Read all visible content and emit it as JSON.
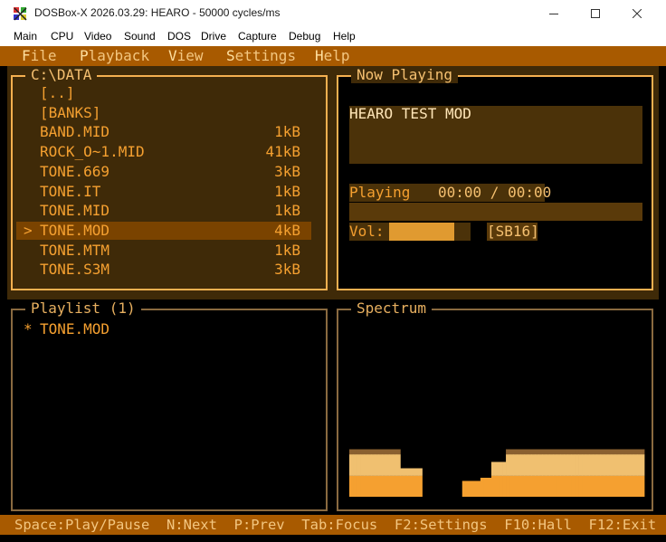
{
  "window": {
    "title": "DOSBox-X 2026.03.29: HEARO - 50000 cycles/ms",
    "icon": "dosbox-icon"
  },
  "host_menu": [
    "Main",
    "CPU",
    "Video",
    "Sound",
    "DOS",
    "Drive",
    "Capture",
    "Debug",
    "Help"
  ],
  "app_menu": [
    {
      "hot": "F",
      "rest": "ile"
    },
    {
      "hot": "P",
      "rest": "layback"
    },
    {
      "hot": "V",
      "rest": "iew"
    },
    {
      "hot": "S",
      "rest": "ettings"
    },
    {
      "hot": "H",
      "rest": "elp"
    }
  ],
  "files_panel": {
    "title": "C:\\DATA",
    "items": [
      {
        "name": "[..]",
        "size": ""
      },
      {
        "name": "[BANKS]",
        "size": ""
      },
      {
        "name": "BAND.MID",
        "size": "1kB"
      },
      {
        "name": "ROCK_O~1.MID",
        "size": "41kB"
      },
      {
        "name": "TONE.669",
        "size": "3kB"
      },
      {
        "name": "TONE.IT",
        "size": "1kB"
      },
      {
        "name": "TONE.MID",
        "size": "1kB"
      },
      {
        "name": "TONE.MOD",
        "size": "4kB"
      },
      {
        "name": "TONE.MTM",
        "size": "1kB"
      },
      {
        "name": "TONE.S3M",
        "size": "3kB"
      }
    ],
    "selected_marker": ">"
  },
  "now_playing": {
    "title": "Now Playing",
    "song": "HEARO TEST MOD",
    "status": "Playing",
    "time": "00:00 / 00:00",
    "volume_label": "Vol:",
    "volume_level": 0.8,
    "device": "[SB16]"
  },
  "playlist": {
    "title": "Playlist (1)",
    "items": [
      {
        "marker": "*",
        "name": "TONE.MOD"
      }
    ]
  },
  "spectrum": {
    "title": "Spectrum",
    "levels": [
      0.75,
      0.75,
      0.75,
      0.75,
      0.75,
      0.75,
      0.75,
      0.75,
      0.75,
      0.75,
      0.75,
      0.75,
      0.75,
      0.75,
      0.45,
      0.45,
      0.45,
      0.45,
      0.45,
      0.45,
      0.0,
      0.0,
      0.0,
      0.0,
      0.0,
      0.0,
      0.0,
      0.0,
      0.0,
      0.0,
      0.0,
      0.25,
      0.25,
      0.25,
      0.25,
      0.25,
      0.3,
      0.3,
      0.3,
      0.55,
      0.55,
      0.55,
      0.55,
      0.75,
      0.75,
      0.75,
      0.75,
      0.75,
      0.75,
      0.75,
      0.75,
      0.75,
      0.75,
      0.75,
      0.75,
      0.75,
      0.75,
      0.75,
      0.75,
      0.75,
      0.75,
      0.75,
      0.75,
      0.75,
      0.75,
      0.75,
      0.75,
      0.75,
      0.75,
      0.75,
      0.75,
      0.75,
      0.75,
      0.75,
      0.75,
      0.75,
      0.75,
      0.75,
      0.75,
      0.75,
      0.75
    ],
    "colors": {
      "low": "#f5a030",
      "mid": "#f0c070",
      "high": "#8a6030"
    }
  },
  "status_bar": "Space:Play/Pause  N:Next  P:Prev  Tab:Focus  F2:Settings  F10:Hall  F12:Exit"
}
